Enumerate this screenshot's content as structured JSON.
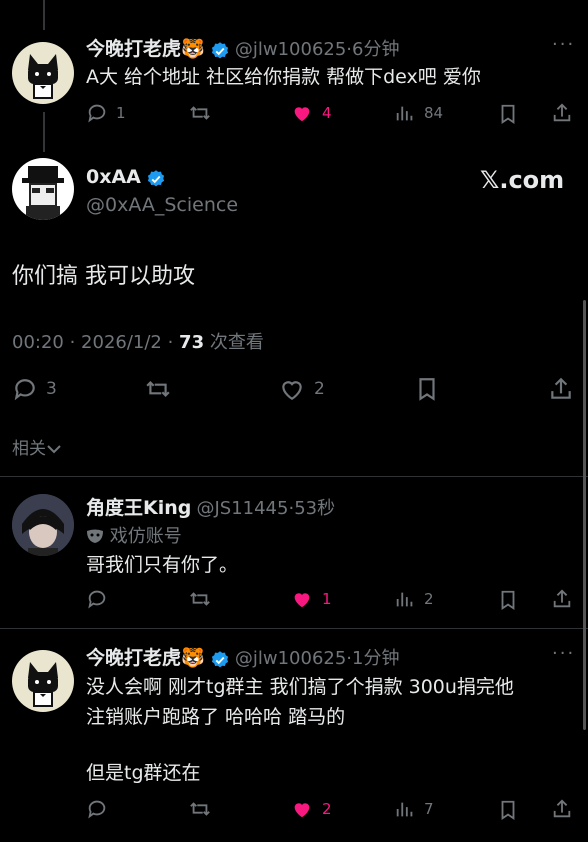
{
  "reply1": {
    "name": "今晚打老虎🐯",
    "handle": "@jlw100625",
    "time": "6分钟",
    "text": "A大 给个地址 社区给你捐款 帮做下dex吧 爱你",
    "replies": "1",
    "retweets": "",
    "likes": "4",
    "views": "84"
  },
  "main": {
    "name": "0xAA",
    "handle": "@0xAA_Science",
    "brand": "𝕏.com",
    "text": "你们搞 我可以助攻",
    "timestamp": "00:20 · 2026/1/2 · ",
    "views_count": "73",
    "views_label": " 次查看",
    "replies": "3",
    "retweets": "",
    "likes": "2",
    "related_label": "相关"
  },
  "reply2": {
    "name": "角度王King",
    "handle": "@JS11445",
    "time": "53秒",
    "parody_label": "戏仿账号",
    "text": "哥我们只有你了。",
    "replies": "",
    "retweets": "",
    "likes": "1",
    "views": "2"
  },
  "reply3": {
    "name": "今晚打老虎🐯",
    "handle": "@jlw100625",
    "time": "1分钟",
    "text_line1": "没人会啊 刚才tg群主 我们搞了个捐款 300u捐完他",
    "text_line2": "注销账户跑路了 哈哈哈 踏马的",
    "text_line3": "但是tg群还在",
    "replies": "",
    "retweets": "",
    "likes": "2",
    "views": "7"
  },
  "colors": {
    "accent": "#1d9bf0",
    "like": "#f91880",
    "muted": "#71767b",
    "text": "#e7e9ea"
  }
}
